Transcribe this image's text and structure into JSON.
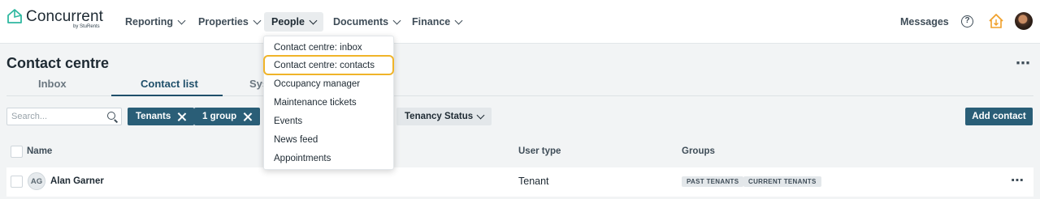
{
  "app": {
    "logo_text": "Concurrent",
    "logo_sub": "by StuRents"
  },
  "nav": {
    "items": [
      {
        "label": "Reporting"
      },
      {
        "label": "Properties"
      },
      {
        "label": "People"
      },
      {
        "label": "Documents"
      },
      {
        "label": "Finance"
      }
    ],
    "messages": "Messages",
    "help": "?"
  },
  "page": {
    "title": "Contact centre",
    "more": "⋯",
    "tabs": [
      {
        "label": "Inbox"
      },
      {
        "label": "Contact list"
      },
      {
        "label": "Sys"
      }
    ]
  },
  "filters": {
    "search_placeholder": "Search...",
    "chips": [
      {
        "label": "Tenants"
      },
      {
        "label": "1 group"
      }
    ],
    "tenancy_status": "Tenancy Status",
    "add_contact": "Add contact"
  },
  "table": {
    "headers": {
      "name": "Name",
      "user_type": "User type",
      "groups": "Groups"
    },
    "rows": [
      {
        "initials": "AG",
        "name": "Alan Garner",
        "user_type": "Tenant",
        "groups": [
          "PAST TENANTS",
          "CURRENT TENANTS"
        ],
        "more": "⋯"
      }
    ]
  },
  "dropdown": {
    "items": [
      {
        "label": "Contact centre: inbox"
      },
      {
        "label": "Contact centre: contacts"
      },
      {
        "label": "Occupancy manager"
      },
      {
        "label": "Maintenance tickets"
      },
      {
        "label": "Events"
      },
      {
        "label": "News feed"
      },
      {
        "label": "Appointments"
      }
    ],
    "highlight_color": "#f0b429"
  },
  "colors": {
    "primary": "#2a5e77",
    "accent_tab": "#1f4f6a"
  }
}
